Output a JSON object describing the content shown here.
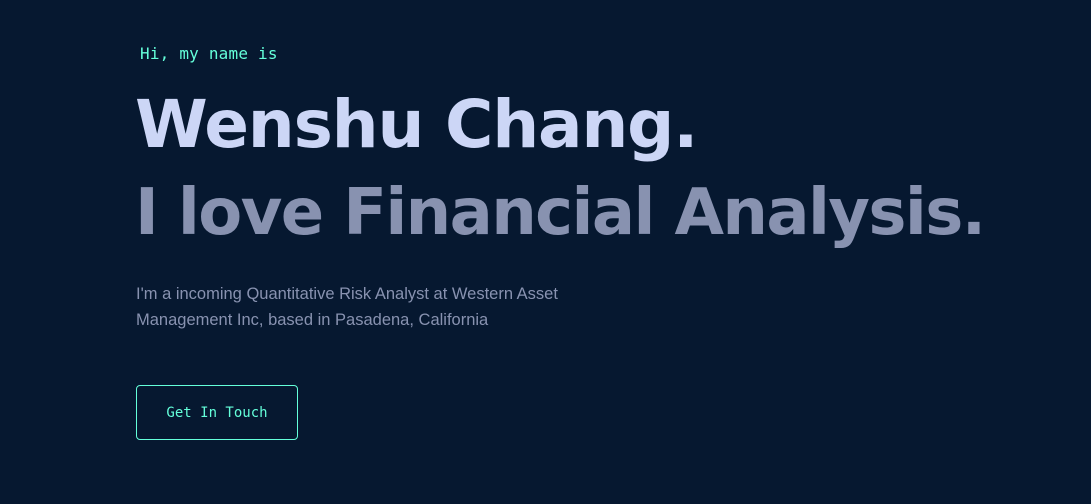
{
  "hero": {
    "greeting": "Hi, my name is",
    "name": "Wenshu Chang.",
    "tagline": "I love Financial Analysis.",
    "description": "I'm a incoming Quantitative Risk Analyst at Western Asset Management Inc, based in Pasadena, California",
    "cta_label": "Get In Touch"
  },
  "colors": {
    "background": "#061830",
    "accent": "#64ffda",
    "heading": "#ccd6f6",
    "muted": "#8892b0"
  }
}
